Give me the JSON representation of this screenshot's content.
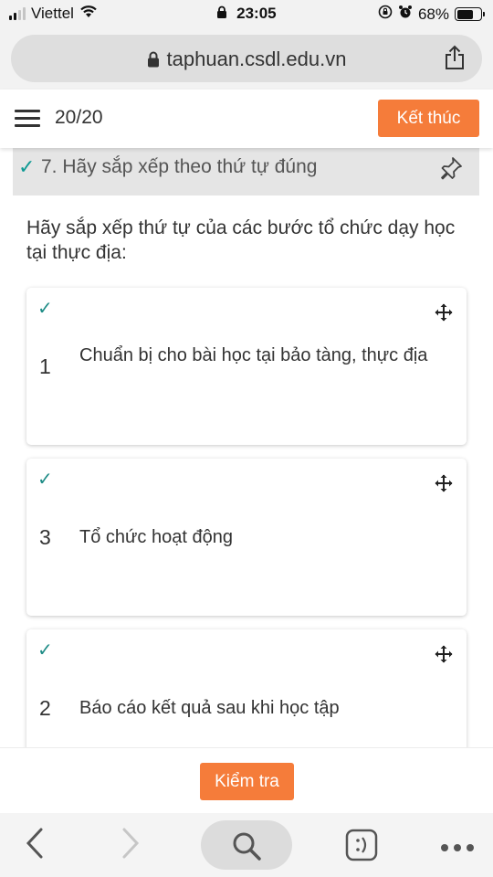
{
  "status_bar": {
    "carrier": "Viettel",
    "time": "23:05",
    "battery": "68%",
    "battery_level": 0.68
  },
  "browser": {
    "url": "taphuan.csdl.edu.vn"
  },
  "header": {
    "progress": "20/20",
    "finish_label": "Kết thúc"
  },
  "question": {
    "title": "7. Hãy sắp xếp theo thứ tự đúng",
    "instruction": "Hãy sắp xếp thứ tự của các bước tổ chức dạy học tại thực địa:",
    "items": [
      {
        "number": "1",
        "text": "Chuẩn bị cho bài học tại bảo tàng, thực địa"
      },
      {
        "number": "3",
        "text": "Tổ chức hoạt động"
      },
      {
        "number": "2",
        "text": "Báo cáo kết quả sau khi học tập"
      }
    ]
  },
  "footer": {
    "check_label": "Kiểm tra"
  },
  "colors": {
    "accent": "#f57c3a",
    "check": "#1e8c86"
  },
  "icons": [
    "wifi-icon",
    "lock-icon",
    "alarm-icon",
    "share-icon",
    "menu-icon",
    "pin-icon",
    "move-icon",
    "back-icon",
    "forward-icon",
    "search-icon",
    "reader-icon",
    "more-icon"
  ]
}
